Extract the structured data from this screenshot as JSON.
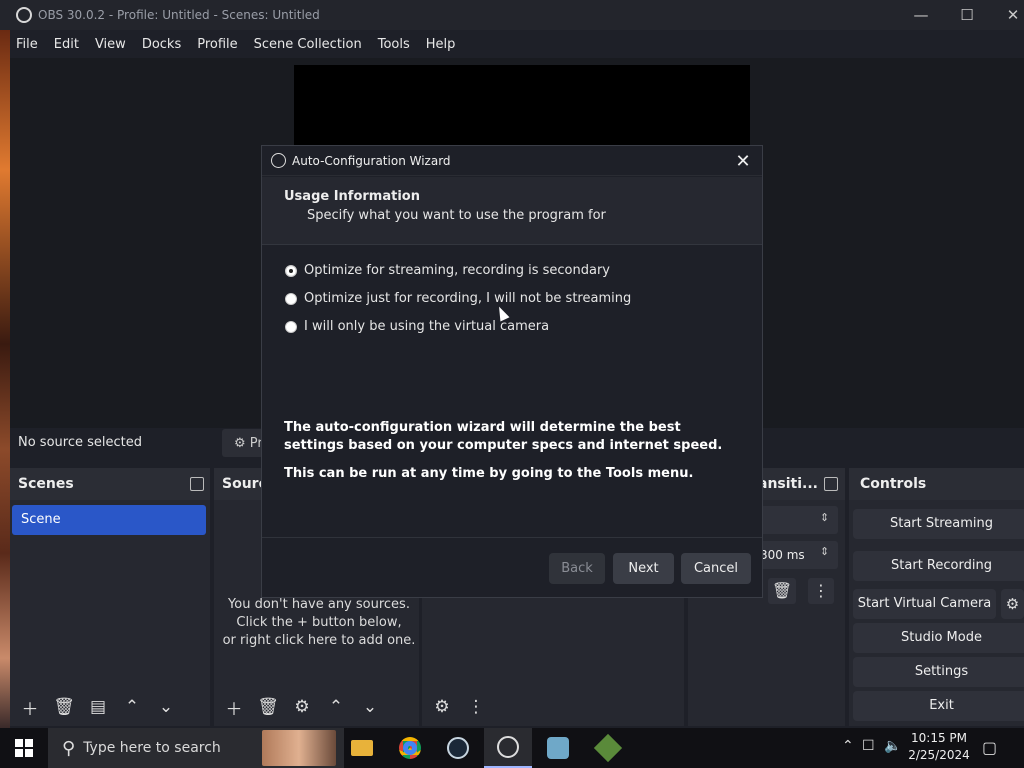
{
  "window": {
    "title": "OBS 30.0.2 - Profile: Untitled - Scenes: Untitled"
  },
  "menu": [
    "File",
    "Edit",
    "View",
    "Docks",
    "Profile",
    "Scene Collection",
    "Tools",
    "Help"
  ],
  "status": {
    "no_source": "No source selected",
    "properties_label": "Pr"
  },
  "docks": {
    "scenes": {
      "title": "Scenes",
      "items": [
        "Scene"
      ]
    },
    "sources": {
      "title": "Sourc",
      "empty_line1": "You don't have any sources.",
      "empty_line2": "Click the + button below,",
      "empty_line3": "or right click here to add one."
    },
    "transitions": {
      "title": "ansiti...",
      "duration": "300 ms"
    },
    "controls": {
      "title": "Controls",
      "buttons": [
        "Start Streaming",
        "Start Recording",
        "Start Virtual Camera",
        "Studio Mode",
        "Settings",
        "Exit"
      ]
    }
  },
  "dialog": {
    "title": "Auto-Configuration Wizard",
    "header_title": "Usage Information",
    "header_sub": "Specify what you want to use the program for",
    "options": [
      {
        "label": "Optimize for streaming, recording is secondary",
        "checked": true
      },
      {
        "label": "Optimize just for recording, I will not be streaming",
        "checked": false
      },
      {
        "label": "I will only be using the virtual camera",
        "checked": false
      }
    ],
    "info_line1": "The auto-configuration wizard will determine the best settings based on your computer specs and internet speed.",
    "info_line2": "This can be run at any time by going to the Tools menu.",
    "buttons": {
      "back": "Back",
      "next": "Next",
      "cancel": "Cancel"
    }
  },
  "taskbar": {
    "search_placeholder": "Type here to search",
    "time": "10:15 PM",
    "date": "2/25/2024",
    "apps": [
      "file-explorer-icon",
      "chrome-icon",
      "steam-icon",
      "obs-icon",
      "app-icon",
      "minecraft-icon"
    ]
  },
  "colors": {
    "accent": "#2a57c8",
    "bg": "#1e2028",
    "dock": "#262830"
  }
}
